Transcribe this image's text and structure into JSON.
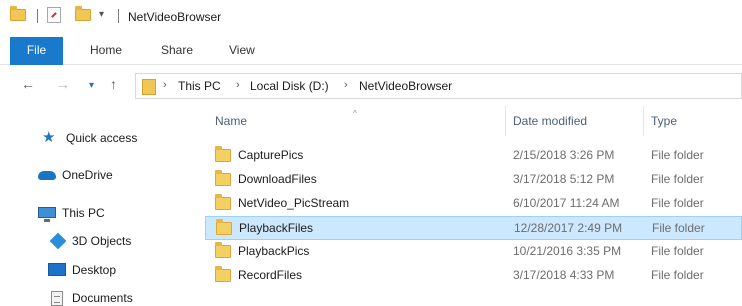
{
  "window": {
    "title": "NetVideoBrowser",
    "quick_access_arrow": "▾"
  },
  "ribbon": {
    "tabs": [
      "File",
      "Home",
      "Share",
      "View"
    ]
  },
  "nav": {
    "back": "←",
    "forward": "→",
    "recent": "▾",
    "up": "↑"
  },
  "address": {
    "separator": "›",
    "crumbs": [
      "This PC",
      "Local Disk (D:)",
      "NetVideoBrowser"
    ]
  },
  "navpane": {
    "items": [
      {
        "label": "Quick access",
        "icon": "star-icon"
      },
      {
        "label": "OneDrive",
        "icon": "cloud-icon"
      },
      {
        "label": "This PC",
        "icon": "computer-icon"
      },
      {
        "label": "3D Objects",
        "icon": "cube-icon"
      },
      {
        "label": "Desktop",
        "icon": "desktop-icon"
      },
      {
        "label": "Documents",
        "icon": "document-icon"
      }
    ]
  },
  "files": {
    "columns": {
      "name": "Name",
      "date": "Date modified",
      "type": "Type"
    },
    "sort_indicator": "^",
    "rows": [
      {
        "name": "CapturePics",
        "date": "2/15/2018 3:26 PM",
        "type": "File folder",
        "selected": false
      },
      {
        "name": "DownloadFiles",
        "date": "3/17/2018 5:12 PM",
        "type": "File folder",
        "selected": false
      },
      {
        "name": "NetVideo_PicStream",
        "date": "6/10/2017 11:24 AM",
        "type": "File folder",
        "selected": false
      },
      {
        "name": "PlaybackFiles",
        "date": "12/28/2017 2:49 PM",
        "type": "File folder",
        "selected": true
      },
      {
        "name": "PlaybackPics",
        "date": "10/21/2016 3:35 PM",
        "type": "File folder",
        "selected": false
      },
      {
        "name": "RecordFiles",
        "date": "3/17/2018 4:33 PM",
        "type": "File folder",
        "selected": false
      }
    ]
  },
  "colors": {
    "file_tab": "#1979ca",
    "selection": "#cce8ff",
    "folder": "#f4cf63"
  }
}
